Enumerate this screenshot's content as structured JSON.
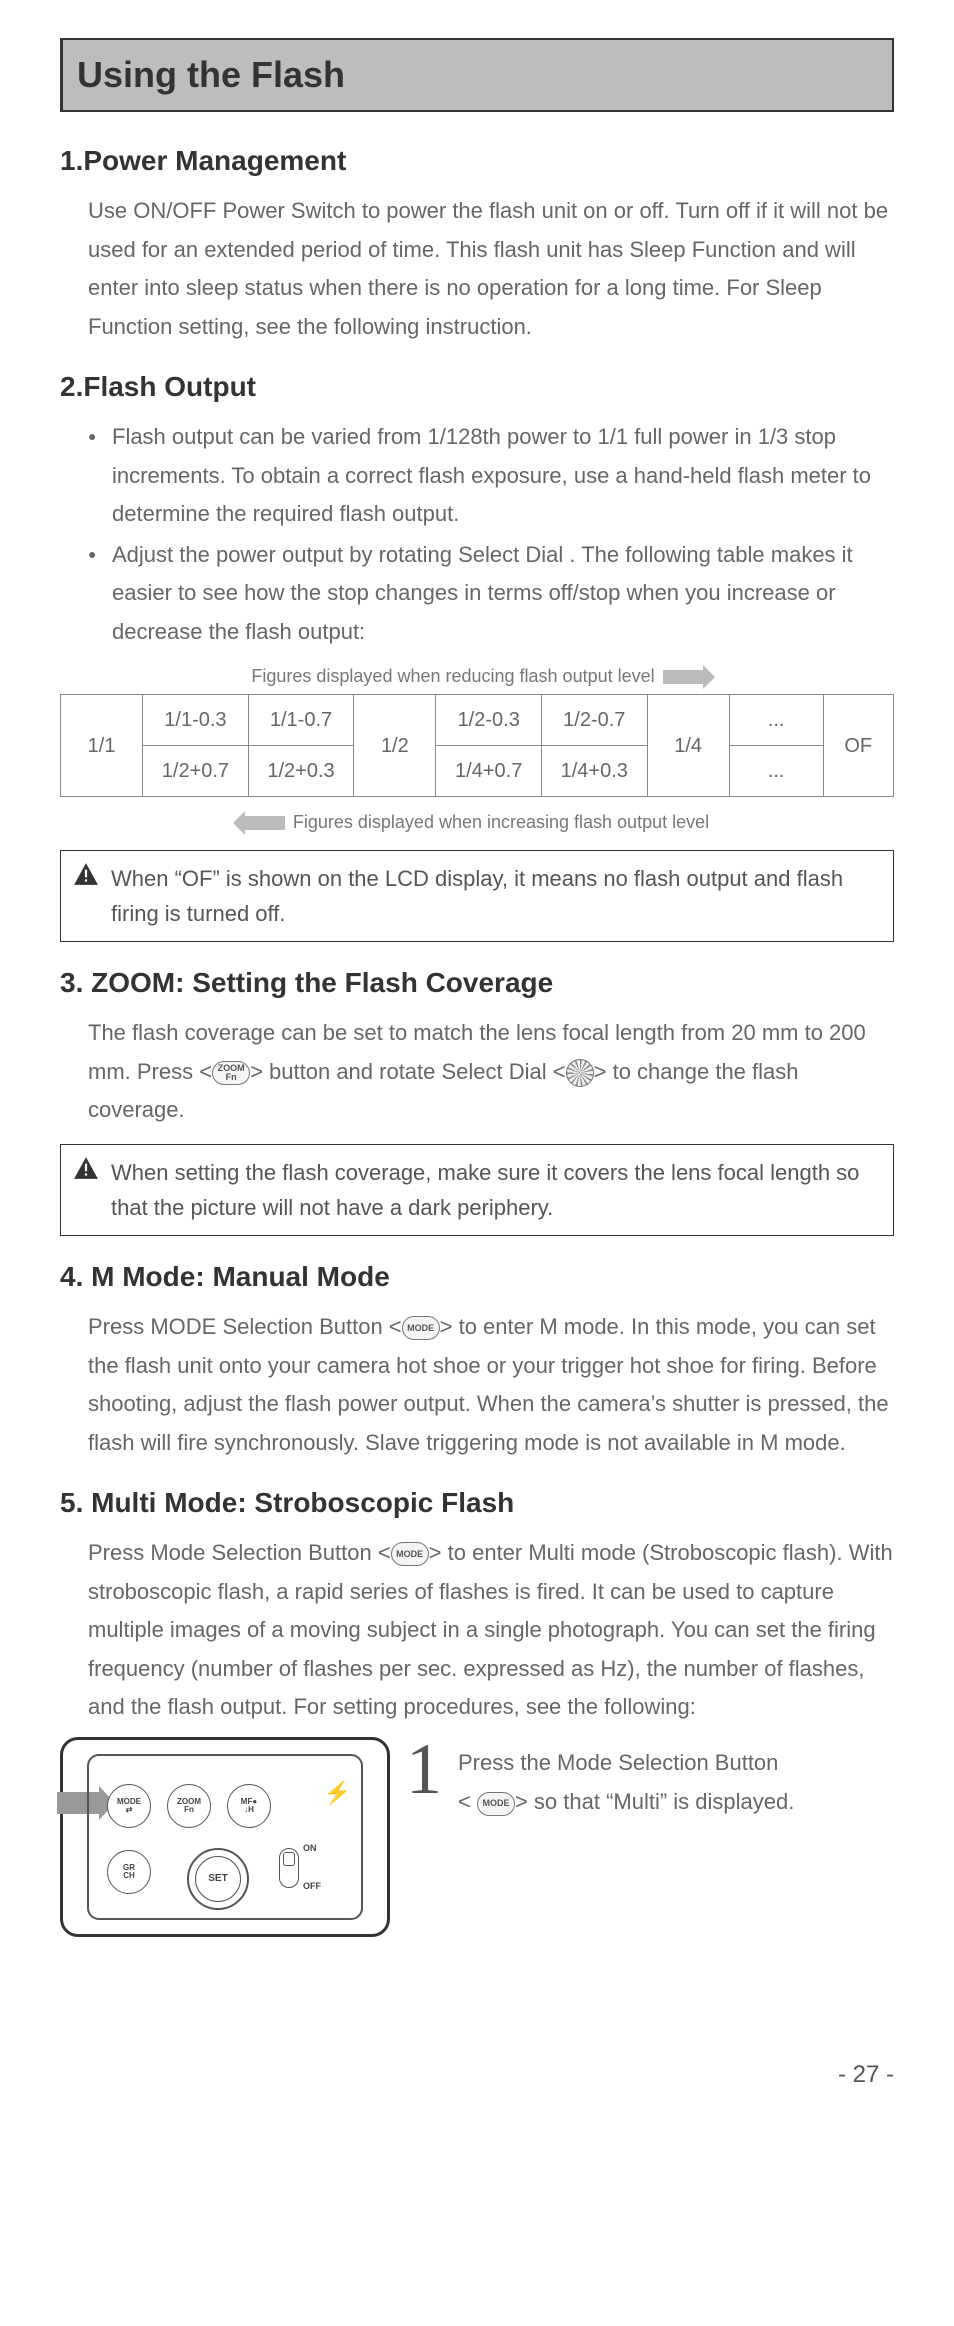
{
  "pageTitle": "Using the Flash",
  "sections": {
    "s1": {
      "heading": "1.Power Management",
      "body": "Use ON/OFF Power Switch to power the flash unit on or off. Turn off if it will not be used for an extended period of time. This flash unit has Sleep Function and will enter into sleep status when there is no operation for a long time. For Sleep Function setting, see the following instruction."
    },
    "s2": {
      "heading": "2.Flash Output",
      "bullet1": "Flash output can be varied from 1/128th power to 1/1 full power in 1/3 stop increments. To obtain a correct flash exposure, use a hand-held flash meter to determine the required flash output.",
      "bullet2": "Adjust the power output by rotating Select Dial . The following table makes it easier to see how the stop changes in terms off/stop when you increase or decrease the flash output:",
      "tableCaptionTop": "Figures displayed when reducing flash output level",
      "tableCaptionBottom": "Figures displayed when increasing flash output level",
      "table": {
        "r1c1": "1/1",
        "r1c2": "1/1-0.3",
        "r1c3": "1/1-0.7",
        "r1c4": "1/2",
        "r1c5": "1/2-0.3",
        "r1c6": "1/2-0.7",
        "r1c7": "1/4",
        "r1c8": "...",
        "r1c9": "OF",
        "r2c2": "1/2+0.7",
        "r2c3": "1/2+0.3",
        "r2c5": "1/4+0.7",
        "r2c6": "1/4+0.3",
        "r2c8": "..."
      },
      "warning": "When “OF” is shown on the LCD display, it means no flash output and flash firing is turned off."
    },
    "s3": {
      "heading": "3. ZOOM: Setting the Flash Coverage",
      "body_a": "The flash coverage can be set to match the lens focal length from 20 mm to 200 mm. Press <",
      "body_b": "> button and rotate Select Dial <",
      "body_c": "> to change the flash coverage.",
      "warning": "When setting the flash coverage, make sure it covers the lens focal length so that the picture will not have a dark periphery."
    },
    "s4": {
      "heading": "4. M Mode: Manual Mode",
      "body_a": "Press MODE Selection Button <",
      "body_b": "> to enter M mode. In this mode, you can set the flash unit onto your camera hot shoe or your trigger hot shoe for firing. Before shooting, adjust the flash power output. When the camera’s shutter is pressed, the flash will fire synchronously. Slave triggering mode is not available in M mode."
    },
    "s5": {
      "heading": "5. Multi Mode: Stroboscopic Flash",
      "body_a": "Press Mode Selection Button <",
      "body_b": "> to enter Multi mode (Stroboscopic flash). With stroboscopic flash, a rapid series of flashes is fired. It can be used to capture multiple images of a moving subject in a single photograph. You can set the firing frequency (number of flashes per sec. expressed as Hz), the number of flashes, and the flash output. For setting procedures, see the following:",
      "step1num": "1",
      "step1_a": "Press the Mode Selection Button",
      "step1_b": "< ",
      "step1_c": "> so that “Multi” is displayed."
    }
  },
  "deviceButtons": {
    "mode": "MODE",
    "modeSub": "⇄",
    "zoom": "ZOOM",
    "zoomSub": "Fn",
    "mf": "MF●",
    "mfSub": "↓H",
    "gr": "GR",
    "grSub": "CH",
    "set": "SET",
    "on": "ON",
    "off": "OFF"
  },
  "icons": {
    "zoomFn": "ZOOM Fn",
    "mode": "MODE"
  },
  "pageNumber": "- 27 -"
}
